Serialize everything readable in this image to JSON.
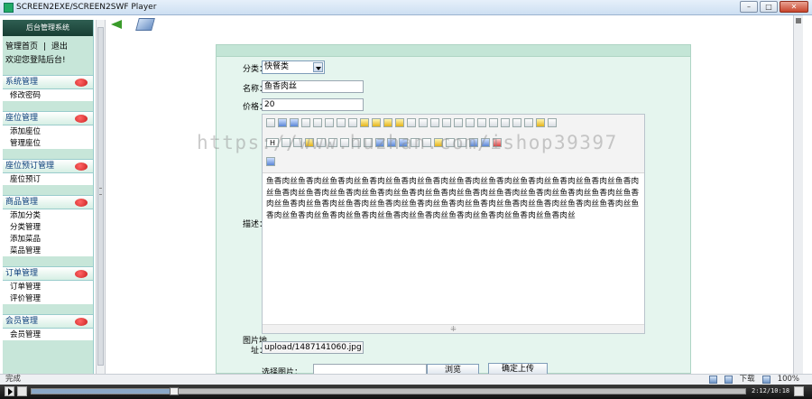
{
  "window": {
    "title": "SCREEN2EXE/SCREEN2SWF Player",
    "buttons": [
      "–",
      "□",
      "✕"
    ]
  },
  "sidebar": {
    "header": "后台管理系统",
    "home_link": "管理首页",
    "separator": "|",
    "logout_link": "退出",
    "welcome": "欢迎您登陆后台!",
    "groups": [
      {
        "title": "系统管理",
        "items": [
          "修改密码"
        ]
      },
      {
        "title": "座位管理",
        "items": [
          "添加座位",
          "管理座位"
        ]
      },
      {
        "title": "座位预订管理",
        "items": [
          "座位预订"
        ]
      },
      {
        "title": "商品管理",
        "items": [
          "添加分类",
          "分类管理",
          "添加菜品",
          "菜品管理"
        ]
      },
      {
        "title": "订单管理",
        "items": [
          "订单管理",
          "评价管理"
        ]
      },
      {
        "title": "会员管理",
        "items": [
          "会员管理"
        ]
      }
    ]
  },
  "form": {
    "category_label": "分类：",
    "category_value": "快餐类",
    "name_label": "名称：",
    "name_value": "鱼香肉丝",
    "price_label": "价格：",
    "price_value": "20",
    "description_label": "描述：",
    "description_text": "鱼香肉丝鱼香肉丝鱼香肉丝鱼香肉丝鱼香肉丝鱼香肉丝鱼香肉丝鱼香肉丝鱼香肉丝鱼香肉丝鱼香肉丝鱼香肉丝鱼香肉丝鱼香肉丝鱼香肉丝鱼香肉丝鱼香肉丝鱼香肉丝鱼香肉丝鱼香肉丝鱼香肉丝鱼香肉丝鱼香肉丝鱼香肉丝鱼香肉丝鱼香肉丝鱼香肉丝鱼香肉丝鱼香肉丝鱼香肉丝鱼香肉丝鱼香肉丝鱼香肉丝鱼香肉丝鱼香肉丝鱼香肉丝鱼香肉丝鱼香肉丝鱼香肉丝鱼香肉丝鱼香肉丝鱼香肉丝鱼香肉丝鱼香肉丝鱼香肉丝",
    "editor_resize": "⁜",
    "image_path_label_1": "图片地",
    "image_path_label_2": "址：",
    "image_path_value": "upload/1487141060.jpg",
    "choose_image_label": "选择图片：",
    "browse_button": "浏览",
    "upload_button": "确定上传"
  },
  "watermark": "https://www.huzhan.com/ishop39397",
  "statusbar": {
    "left": "完成",
    "download": "下载",
    "zoom": "100%"
  },
  "player": {
    "time": "2:12/10:18",
    "progress": 0.2
  }
}
